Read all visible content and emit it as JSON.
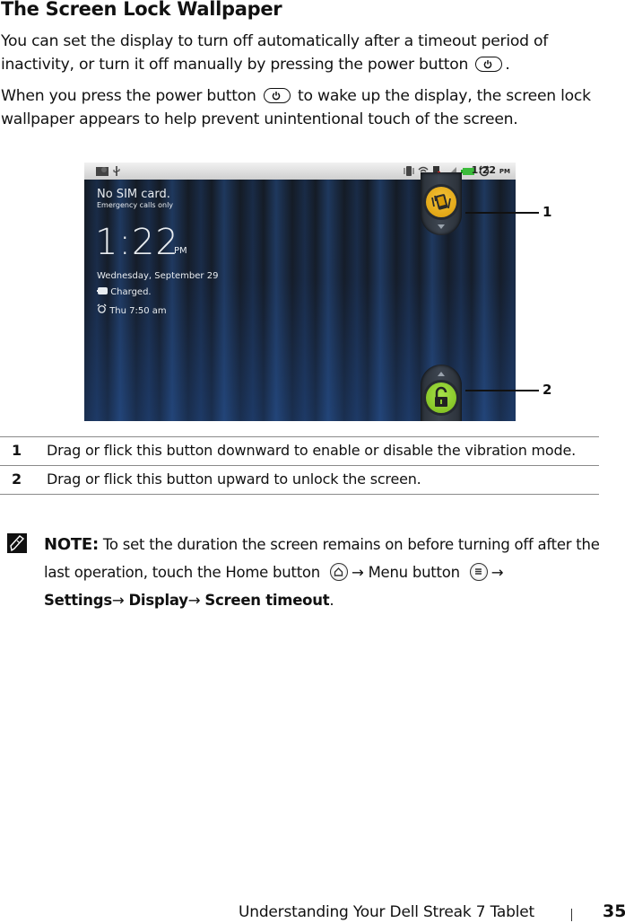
{
  "heading": "The Screen Lock Wallpaper",
  "paragraphs": {
    "p1_before_icon": "You can set the display to turn off automatically after a timeout period of inactivity, or turn it off manually by pressing the power button",
    "p1_after_icon": ".",
    "p2_before_icon": "When you press the power button",
    "p2_after_icon": "to wake up the display, the screen lock wallpaper appears to help prevent unintentional touch of the screen."
  },
  "inline_icons": {
    "power": "power-button-icon",
    "home": "home-button-icon",
    "menu": "menu-button-icon",
    "note": "pencil-note-icon"
  },
  "screenshot": {
    "status_bar": {
      "left_icons": [
        "notification-icon",
        "usb-icon"
      ],
      "right_icons": [
        "vibrate-icon",
        "wifi-icon",
        "sim-missing-icon",
        "signal-icon",
        "battery-icon",
        "alarm-icon"
      ],
      "time": "1:22",
      "ampm": "PM"
    },
    "carrier": "No SIM card.",
    "carrier_sub": "Emergency calls only",
    "clock": "1:22",
    "clock_ampm": "PM",
    "date": "Wednesday, September 29",
    "battery_status": "Charged.",
    "alarm": "Thu 7:50 am",
    "accent_vibrate": "#e8ac16",
    "accent_unlock": "#8ccc2a",
    "callouts": [
      "1",
      "2"
    ]
  },
  "legend": [
    {
      "num": "1",
      "text": "Drag or flick this button downward to enable or disable the vibration mode."
    },
    {
      "num": "2",
      "text": "Drag or flick this button upward to unlock the screen."
    }
  ],
  "note": {
    "label": "NOTE:",
    "text1": "To set the duration the screen remains on before turning off after the last operation, touch the Home button",
    "arrow": "→",
    "text2": "Menu button",
    "path": [
      "Settings",
      "Display",
      "Screen timeout"
    ],
    "end": "."
  },
  "footer": {
    "chapter": "Understanding Your Dell Streak 7 Tablet",
    "page": "35"
  }
}
